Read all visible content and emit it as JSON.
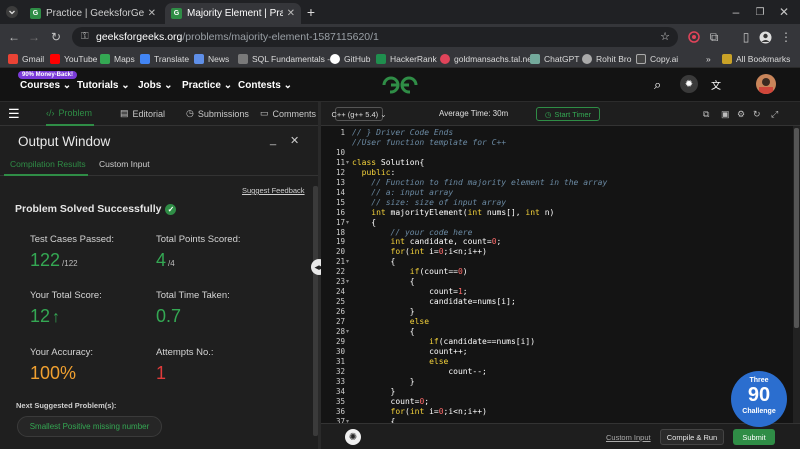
{
  "browser": {
    "tabs": [
      {
        "title": "Practice | GeeksforGeeks | A co",
        "active": false
      },
      {
        "title": "Majority Element | Practice | Ge",
        "active": true
      }
    ],
    "url_host": "geeksforgeeks.org",
    "url_path": "/problems/majority-element-1587115620/1",
    "bookmarks": [
      "Gmail",
      "YouTube",
      "Maps",
      "Translate",
      "News",
      "SQL Fundamentals -...",
      "GitHub",
      "HackerRank",
      "goldmansachs.tal.net",
      "ChatGPT",
      "Rohit Bro",
      "Copy.ai"
    ],
    "all_bookmarks": "All Bookmarks"
  },
  "site": {
    "badge": "90% Money-Back!",
    "menu": [
      "Courses",
      "Tutorials",
      "Jobs",
      "Practice",
      "Contests"
    ],
    "logo": "GG"
  },
  "problem_tabs": [
    "Problem",
    "Editorial",
    "Submissions",
    "Comments"
  ],
  "output": {
    "title": "Output Window",
    "tabs": [
      "Compilation Results",
      "Custom Input"
    ],
    "suggest_feedback": "Suggest Feedback",
    "status": "Problem Solved Successfully",
    "test_cases_label": "Test Cases Passed:",
    "test_cases_value": "122",
    "test_cases_total": "/122",
    "points_label": "Total Points Scored:",
    "points_value": "4",
    "points_total": "/4",
    "score_label": "Your Total Score:",
    "score_value": "12",
    "time_label": "Total Time Taken:",
    "time_value": "0.7",
    "accuracy_label": "Your Accuracy:",
    "accuracy_value": "100%",
    "attempts_label": "Attempts No.:",
    "attempts_value": "1",
    "next_label": "Next Suggested Problem(s):",
    "next_problem": "Smallest Positive missing number"
  },
  "editor": {
    "language": "C++ (g++ 5.4)",
    "average_time": "Average Time: 30m",
    "start_timer": "Start Timer",
    "lines": [
      {
        "n": "1",
        "t": "// } Driver Code Ends"
      },
      {
        "n": "",
        "t": "//User function template for C++"
      },
      {
        "n": "10",
        "t": ""
      },
      {
        "n": "11",
        "t": "class Solution{"
      },
      {
        "n": "12",
        "t": "  public:"
      },
      {
        "n": "13",
        "t": "    // Function to find majority element in the array"
      },
      {
        "n": "14",
        "t": "    // a: input array"
      },
      {
        "n": "15",
        "t": "    // size: size of input array"
      },
      {
        "n": "16",
        "t": "    int majorityElement(int nums[], int n)"
      },
      {
        "n": "17",
        "t": "    {"
      },
      {
        "n": "18",
        "t": "        // your code here"
      },
      {
        "n": "19",
        "t": "        int candidate, count=0;"
      },
      {
        "n": "20",
        "t": "        for(int i=0;i<n;i++)"
      },
      {
        "n": "21",
        "t": "        {"
      },
      {
        "n": "22",
        "t": "            if(count==0)"
      },
      {
        "n": "23",
        "t": "            {"
      },
      {
        "n": "24",
        "t": "                count=1;"
      },
      {
        "n": "25",
        "t": "                candidate=nums[i];"
      },
      {
        "n": "26",
        "t": "            }"
      },
      {
        "n": "27",
        "t": "            else"
      },
      {
        "n": "28",
        "t": "            {"
      },
      {
        "n": "29",
        "t": "                if(candidate==nums[i])"
      },
      {
        "n": "30",
        "t": "                count++;"
      },
      {
        "n": "31",
        "t": "                else"
      },
      {
        "n": "32",
        "t": "                    count--;"
      },
      {
        "n": "33",
        "t": "            }"
      },
      {
        "n": "34",
        "t": "        }"
      },
      {
        "n": "35",
        "t": "        count=0;"
      },
      {
        "n": "36",
        "t": "        for(int i=0;i<n;i++)"
      },
      {
        "n": "37",
        "t": "        {"
      }
    ],
    "custom_input": "Custom Input",
    "compile_run": "Compile & Run",
    "submit": "Submit"
  },
  "challenge": {
    "top": "Three",
    "number": "90",
    "bottom": "Challenge"
  },
  "colors": {
    "accent": "#2f8d46",
    "success": "#34a853",
    "accuracy": "#f0a030",
    "attempts": "#e03b3b"
  }
}
